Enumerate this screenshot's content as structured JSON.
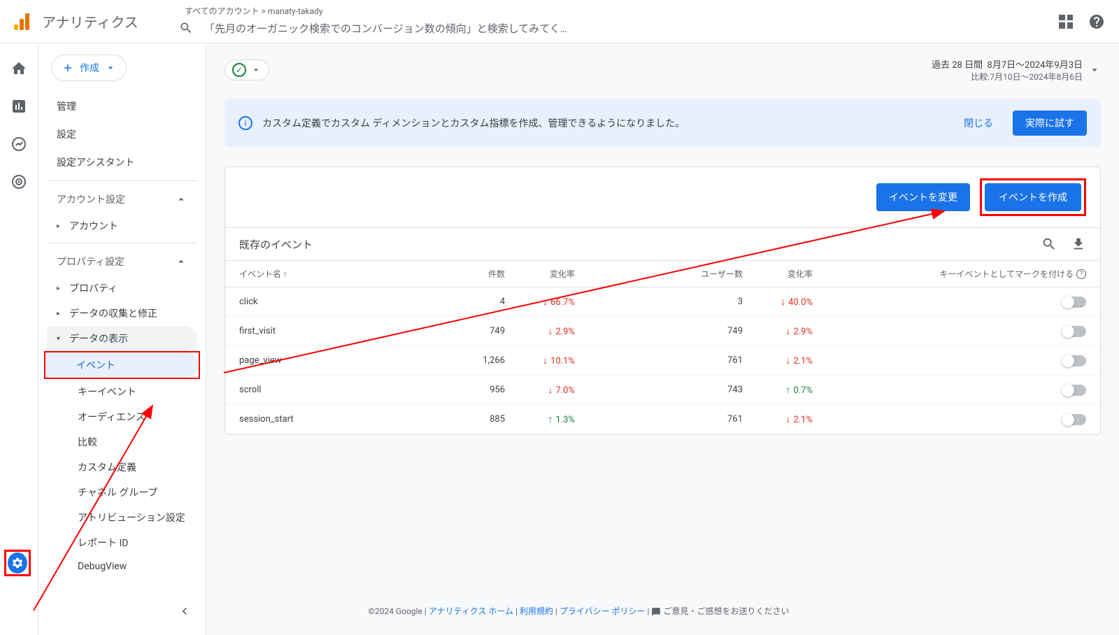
{
  "app_title": "アナリティクス",
  "breadcrumb": {
    "all": "すべてのアカウント",
    "property": "manaty-takady"
  },
  "search_placeholder": "「先月のオーガニック検索でのコンバージョン数の傾向」と検索してみてく…",
  "create_button": "作成",
  "sidebar": {
    "admin": "管理",
    "settings": "設定",
    "setup_assistant": "設定アシスタント",
    "account_settings": "アカウント設定",
    "account": "アカウント",
    "property_settings": "プロパティ設定",
    "property": "プロパティ",
    "data_collection": "データの収集と修正",
    "data_display": "データの表示",
    "events": "イベント",
    "key_events": "キーイベント",
    "audiences": "オーディエンス",
    "compare": "比較",
    "custom_definitions": "カスタム定義",
    "channel_groups": "チャネル グループ",
    "attribution": "アトリビューション設定",
    "report_id": "レポート ID",
    "debugview": "DebugView"
  },
  "date_range": {
    "label": "過去 28 日間",
    "range": "8月7日～2024年9月3日",
    "compare": "比較:7月10日～2024年8月6日"
  },
  "banner": {
    "text": "カスタム定義でカスタム ディメンションとカスタム指標を作成、管理できるようになりました。",
    "close": "閉じる",
    "try": "実際に試す"
  },
  "actions": {
    "modify_event": "イベントを変更",
    "create_event": "イベントを作成"
  },
  "table": {
    "title": "既存のイベント",
    "headers": {
      "name": "イベント名",
      "count": "件数",
      "rate": "変化率",
      "users": "ユーザー数",
      "rate2": "変化率",
      "key": "キーイベントとしてマークを付ける"
    },
    "rows": [
      {
        "name": "click",
        "count": "4",
        "rate": "66.7%",
        "rate_dir": "down",
        "users": "3",
        "rate2": "40.0%",
        "rate2_dir": "down"
      },
      {
        "name": "first_visit",
        "count": "749",
        "rate": "2.9%",
        "rate_dir": "down",
        "users": "749",
        "rate2": "2.9%",
        "rate2_dir": "down"
      },
      {
        "name": "page_view",
        "count": "1,266",
        "rate": "10.1%",
        "rate_dir": "down",
        "users": "761",
        "rate2": "2.1%",
        "rate2_dir": "down"
      },
      {
        "name": "scroll",
        "count": "956",
        "rate": "7.0%",
        "rate_dir": "down",
        "users": "743",
        "rate2": "0.7%",
        "rate2_dir": "up"
      },
      {
        "name": "session_start",
        "count": "885",
        "rate": "1.3%",
        "rate_dir": "up",
        "users": "761",
        "rate2": "2.1%",
        "rate2_dir": "down"
      }
    ]
  },
  "footer": {
    "copyright": "©2024 Google",
    "home": "アナリティクス ホーム",
    "terms": "利用規約",
    "privacy": "プライバシー ポリシー",
    "feedback": "ご意見・ご感想をお送りください"
  }
}
